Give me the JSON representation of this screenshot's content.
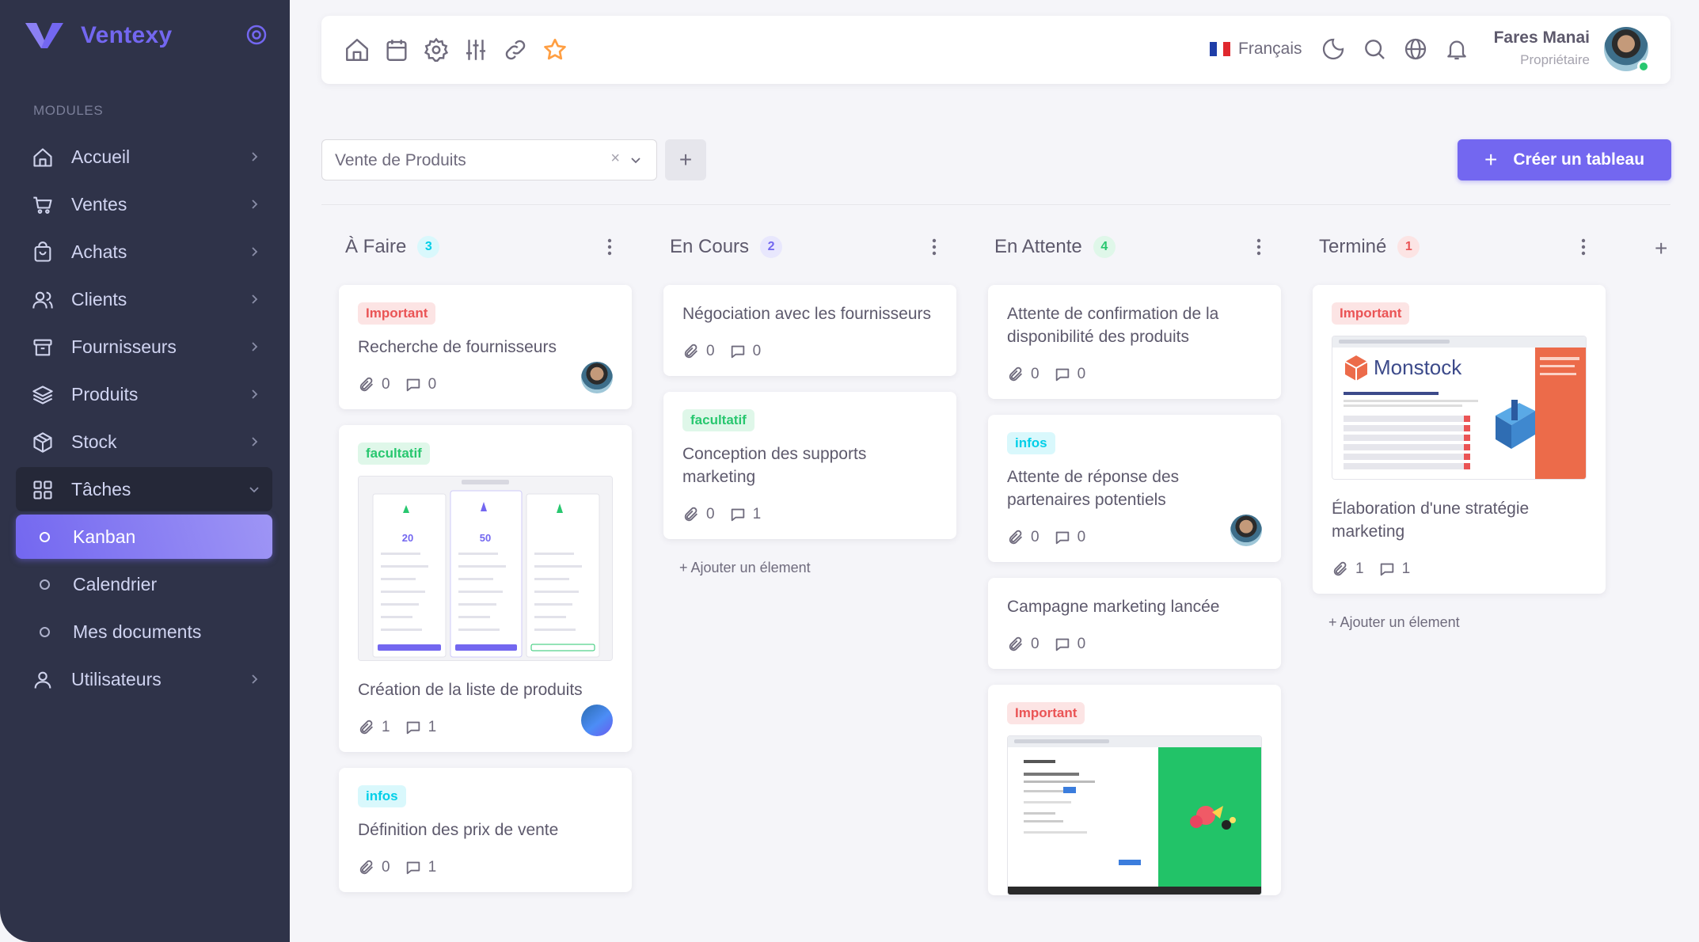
{
  "brand": {
    "name": "Ventexy"
  },
  "sidebar": {
    "section_title": "MODULES",
    "items": [
      {
        "label": "Accueil"
      },
      {
        "label": "Ventes"
      },
      {
        "label": "Achats"
      },
      {
        "label": "Clients"
      },
      {
        "label": "Fournisseurs"
      },
      {
        "label": "Produits"
      },
      {
        "label": "Stock"
      },
      {
        "label": "Tâches"
      }
    ],
    "subitems": [
      {
        "label": "Kanban"
      },
      {
        "label": "Calendrier"
      },
      {
        "label": "Mes documents"
      }
    ],
    "users_label": "Utilisateurs"
  },
  "topbar": {
    "language": "Français",
    "user_name": "Fares Manai",
    "user_role": "Propriétaire"
  },
  "controls": {
    "board_select": "Vente de Produits",
    "clear": "×",
    "add": "+",
    "create_label": "Créer un tableau",
    "create_plus": "+"
  },
  "board": {
    "add_column": "+",
    "add_item_label": "+ Ajouter un élement",
    "columns": [
      {
        "title": "À Faire",
        "count": "3",
        "badge_bg": "#d9f8fc",
        "badge_fg": "#00cfe8",
        "cards": [
          {
            "tag": "Important",
            "title": "Recherche de fournisseurs",
            "attachments": "0",
            "comments": "0"
          },
          {
            "tag": "facultatif",
            "title": "Création de la liste de produits",
            "attachments": "1",
            "comments": "1"
          },
          {
            "tag": "infos",
            "title": "Définition des prix de vente",
            "attachments": "0",
            "comments": "1"
          }
        ]
      },
      {
        "title": "En Cours",
        "count": "2",
        "badge_bg": "#e8e7fd",
        "badge_fg": "#7367f0",
        "cards": [
          {
            "title": "Négociation avec les fournisseurs",
            "attachments": "0",
            "comments": "0"
          },
          {
            "tag": "facultatif",
            "title": "Conception des supports marketing",
            "attachments": "0",
            "comments": "1"
          }
        ]
      },
      {
        "title": "En Attente",
        "count": "4",
        "badge_bg": "#dff7e9",
        "badge_fg": "#28c76f",
        "cards": [
          {
            "title": "Attente de confirmation de la disponibilité des produits",
            "attachments": "0",
            "comments": "0"
          },
          {
            "tag": "infos",
            "title": "Attente de réponse des partenaires potentiels",
            "attachments": "0",
            "comments": "0"
          },
          {
            "title": "Campagne marketing lancée",
            "attachments": "0",
            "comments": "0"
          },
          {
            "tag": "Important"
          }
        ]
      },
      {
        "title": "Terminé",
        "count": "1",
        "badge_bg": "#fce4e4",
        "badge_fg": "#ea5455",
        "cards": [
          {
            "tag": "Important",
            "title": "Élaboration d'une stratégie marketing",
            "attachments": "1",
            "comments": "1",
            "thumb_text": "Monstock"
          }
        ]
      }
    ]
  },
  "thumbnails": {
    "pricing_prices": [
      "20",
      "50"
    ]
  },
  "colors": {
    "accent": "#7367f0",
    "sidebar_bg": "#2f3349",
    "success": "#28c76f",
    "danger": "#ea5455",
    "info": "#00cfe8"
  }
}
